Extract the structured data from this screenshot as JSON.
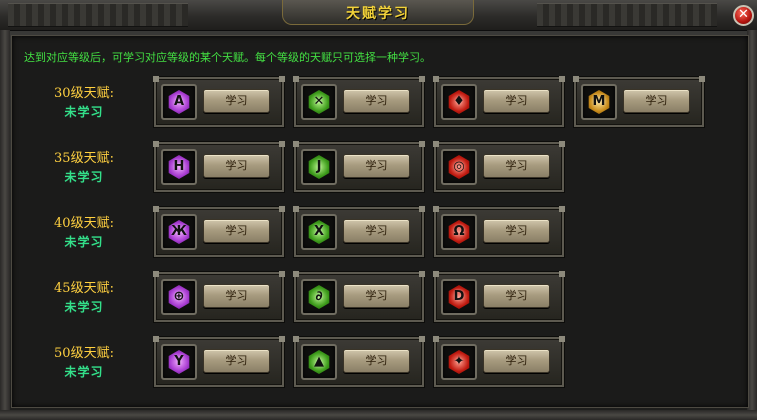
{
  "window": {
    "title": "天赋学习"
  },
  "close_icon_glyph": "✕",
  "instruction": "达到对应等级后，可学习对应等级的某个天赋。每个等级的天赋只可选择一种学习。",
  "rows": [
    {
      "level_label": "30级天赋:",
      "status": "未学习",
      "talents": [
        {
          "icon": "purple-talent-rune-icon",
          "color": "#a63ad0",
          "glyph": "A",
          "button": "学习"
        },
        {
          "icon": "green-talent-rune-icon",
          "color": "#3c9a1a",
          "glyph": "✕",
          "button": "学习"
        },
        {
          "icon": "red-talent-rune-icon",
          "color": "#c01a10",
          "glyph": "♦",
          "button": "学习"
        },
        {
          "icon": "gold-talent-rune-icon",
          "color": "#c78a1a",
          "glyph": "M",
          "button": "学习"
        }
      ]
    },
    {
      "level_label": "35级天赋:",
      "status": "未学习",
      "talents": [
        {
          "icon": "purple-talent-rune-icon",
          "color": "#a63ad0",
          "glyph": "H",
          "button": "学习"
        },
        {
          "icon": "green-talent-rune-icon",
          "color": "#3c9a1a",
          "glyph": "J",
          "button": "学习"
        },
        {
          "icon": "red-talent-rune-icon",
          "color": "#c01a10",
          "glyph": "◎",
          "button": "学习"
        }
      ]
    },
    {
      "level_label": "40级天赋:",
      "status": "未学习",
      "talents": [
        {
          "icon": "purple-talent-rune-icon",
          "color": "#a63ad0",
          "glyph": "Ж",
          "button": "学习"
        },
        {
          "icon": "green-talent-rune-icon",
          "color": "#3c9a1a",
          "glyph": "X",
          "button": "学习"
        },
        {
          "icon": "red-talent-rune-icon",
          "color": "#c01a10",
          "glyph": "Ω",
          "button": "学习"
        }
      ]
    },
    {
      "level_label": "45级天赋:",
      "status": "未学习",
      "talents": [
        {
          "icon": "purple-talent-rune-icon",
          "color": "#a63ad0",
          "glyph": "⊕",
          "button": "学习"
        },
        {
          "icon": "green-talent-rune-icon",
          "color": "#3c9a1a",
          "glyph": "∂",
          "button": "学习"
        },
        {
          "icon": "red-talent-rune-icon",
          "color": "#c01a10",
          "glyph": "D",
          "button": "学习"
        }
      ]
    },
    {
      "level_label": "50级天赋:",
      "status": "未学习",
      "talents": [
        {
          "icon": "purple-talent-rune-icon",
          "color": "#a63ad0",
          "glyph": "Y",
          "button": "学习"
        },
        {
          "icon": "green-talent-rune-icon",
          "color": "#3c9a1a",
          "glyph": "▲",
          "button": "学习"
        },
        {
          "icon": "red-talent-rune-icon",
          "color": "#c01a10",
          "glyph": "✦",
          "button": "学习"
        }
      ]
    }
  ]
}
